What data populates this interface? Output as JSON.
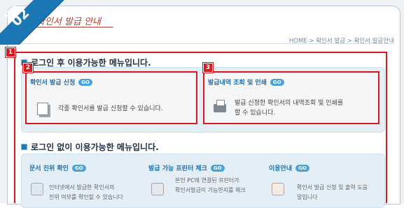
{
  "step": {
    "word": "STEP",
    "number": "02"
  },
  "page_title": "확인서 발급 안내",
  "breadcrumb": "HOME > 확인서 발급 > 확인서 발급안내",
  "annotations": {
    "badge1": "1",
    "badge2": "2",
    "badge3": "3"
  },
  "login_section": {
    "title": "로그인 후 이용가능한 메뉴입니다.",
    "items": [
      {
        "title": "확인서 발급 신청",
        "go": "GO",
        "desc": "각종 확인서를 발급 신청할 수 있습니다."
      },
      {
        "title": "발급내역 조회 및 인쇄",
        "go": "GO",
        "desc_line1": "발급 신청한 확인서의 내역조회 및 인쇄를",
        "desc_line2": "할 수 있습니다."
      }
    ]
  },
  "guest_section": {
    "title": "로그인 없이 이용가능한 메뉴입니다.",
    "items": [
      {
        "title": "문서 진위 확인",
        "go": "GO",
        "desc_line1": "인터넷에서 발급한 확인서의",
        "desc_line2": "진위 여부를 확인할 수 있습니다"
      },
      {
        "title": "발급 가능 프린터 체크",
        "go": "GO",
        "desc_line1": "본인 PC에 연결된 프린터가",
        "desc_line2": "확인서발급이 가능한지를 체크"
      },
      {
        "title": "이용안내",
        "go": "GO",
        "desc_line1": "확인서 발급 신청 및 출력 도움",
        "desc_line2": "말입니다"
      }
    ]
  },
  "colors": {
    "accent": "#1b78b4",
    "annotation_red": "#d71920",
    "title_red": "#c0392b"
  }
}
